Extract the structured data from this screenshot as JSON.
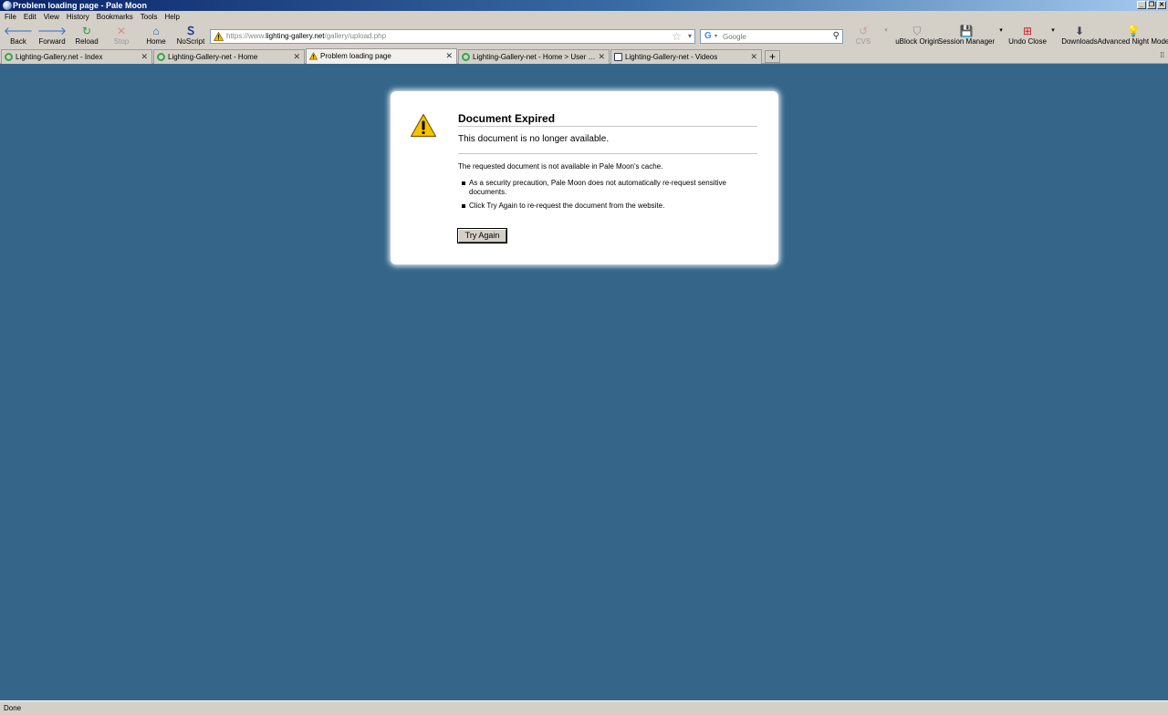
{
  "window": {
    "title": "Problem loading page - Pale Moon"
  },
  "menu": [
    "File",
    "Edit",
    "View",
    "History",
    "Bookmarks",
    "Tools",
    "Help"
  ],
  "toolbar": {
    "back": "Back",
    "forward": "Forward",
    "reload": "Reload",
    "stop": "Stop",
    "home": "Home",
    "noscript": "NoScript",
    "cvs": "CVS",
    "ublock": "uBlock Origin",
    "session_manager": "Session Manager",
    "undo_close": "Undo Close",
    "downloads": "Downloads",
    "night_mode": "Advanced Night Mode"
  },
  "url": {
    "prefix": "https://www.",
    "host": "lighting-gallery.net",
    "path": "/gallery/upload.php"
  },
  "search": {
    "placeholder": "Google"
  },
  "tabs": [
    {
      "label": "Lighting-Gallery.net - Index"
    },
    {
      "label": "Lighting-Gallery-net - Home"
    },
    {
      "label": "Problem loading page"
    },
    {
      "label": "Lighting-Gallery-net - Home > User galler..."
    },
    {
      "label": "Lighting-Gallery-net - Videos"
    }
  ],
  "error": {
    "title": "Document Expired",
    "subtitle": "This document is no longer available.",
    "description": "The requested document is not available in Pale Moon's cache.",
    "bullets": [
      "As a security precaution, Pale Moon does not automatically re-request sensitive documents.",
      "Click Try Again to re-request the document from the website."
    ],
    "button": "Try Again"
  },
  "status": {
    "text": "Done"
  },
  "colors": {
    "content_bg": "#35668a",
    "title_bar": "#0a246a"
  }
}
